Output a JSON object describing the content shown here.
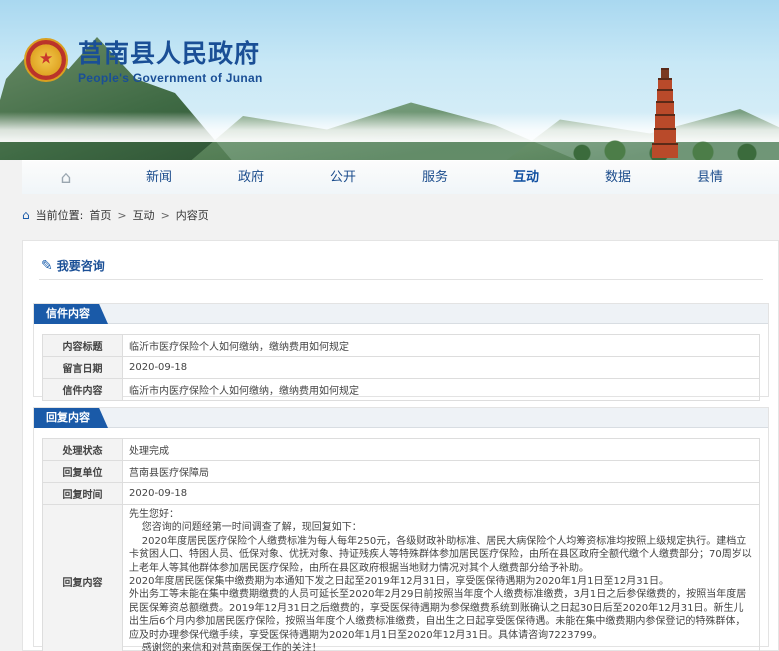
{
  "site": {
    "title_cn": "莒南县人民政府",
    "title_en": "People's Government of Junan"
  },
  "nav": {
    "home_icon": "home-icon",
    "items": [
      "新闻",
      "政府",
      "公开",
      "服务",
      "互动",
      "数据",
      "县情"
    ],
    "active": "互动"
  },
  "breadcrumb": {
    "label": "当前位置:",
    "items": [
      "首页",
      "互动",
      "内容页"
    ]
  },
  "panel": {
    "title": "我要咨询"
  },
  "letter": {
    "section_title": "信件内容",
    "rows": [
      {
        "key": "内容标题",
        "value": "临沂市医疗保险个人如何缴纳，缴纳费用如何规定"
      },
      {
        "key": "留言日期",
        "value": "2020-09-18"
      },
      {
        "key": "信件内容",
        "value": "临沂市内医疗保险个人如何缴纳，缴纳费用如何规定"
      }
    ]
  },
  "reply": {
    "section_title": "回复内容",
    "rows": [
      {
        "key": "处理状态",
        "value": "处理完成"
      },
      {
        "key": "回复单位",
        "value": "莒南县医疗保障局"
      },
      {
        "key": "回复时间",
        "value": "2020-09-18"
      }
    ],
    "content_key": "回复内容",
    "content": [
      "先生您好：",
      "    您咨询的问题经第一时间调查了解，现回复如下：",
      "    2020年度居民医疗保险个人缴费标准为每人每年250元，各级财政补助标准、居民大病保险个人均筹资标准均按照上级规定执行。建档立卡贫困人口、特困人员、低保对象、优抚对象、持证残疾人等特殊群体参加居民医疗保险，由所在县区政府全额代缴个人缴费部分；70周岁以上老年人等其他群体参加居民医疗保险，由所在县区政府根据当地财力情况对其个人缴费部分给予补助。",
      "2020年度居民医保集中缴费期为本通知下发之日起至2019年12月31日，享受医保待遇期为2020年1月1日至12月31日。",
      "外出务工等未能在集中缴费期缴费的人员可延长至2020年2月29日前按照当年度个人缴费标准缴费，3月1日之后参保缴费的，按照当年度居民医保筹资总额缴费。2019年12月31日之后缴费的，享受医保待遇期为参保缴费系统到账确认之日起30日后至2020年12月31日。新生儿出生后6个月内参加居民医疗保险，按照当年度个人缴费标准缴费，自出生之日起享受医保待遇。未能在集中缴费期内参保登记的特殊群体，应及时办理参保代缴手续，享受医保待遇期为2020年1月1日至2020年12月31日。具体请咨询7223799。",
      "    感谢您的来信和对莒南医保工作的关注！"
    ]
  },
  "colors": {
    "brand_blue": "#1a5aa8",
    "title_blue": "#1a4f96"
  }
}
